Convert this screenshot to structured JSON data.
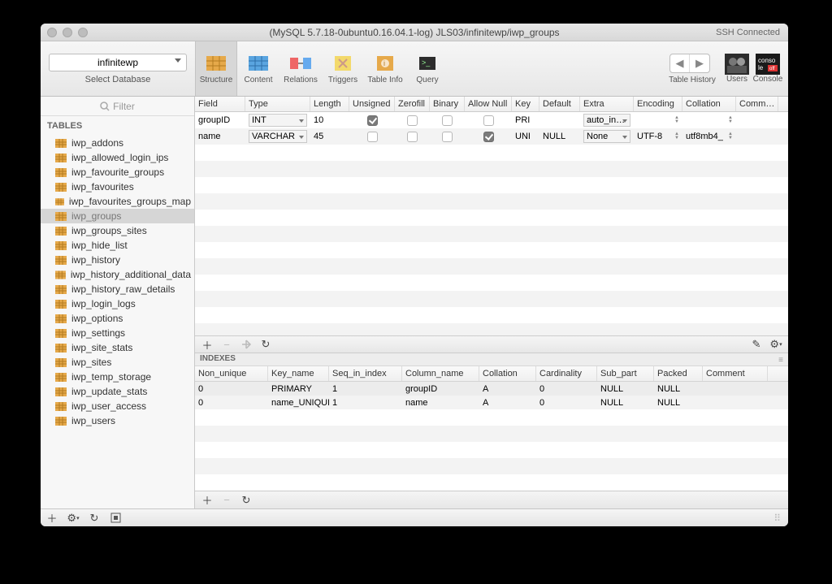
{
  "title": "(MySQL 5.7.18-0ubuntu0.16.04.1-log) JLS03/infinitewp/iwp_groups",
  "ssh_status": "SSH Connected",
  "db_selector": {
    "value": "infinitewp",
    "label": "Select Database"
  },
  "toolbar_icons": [
    {
      "label": "Structure"
    },
    {
      "label": "Content"
    },
    {
      "label": "Relations"
    },
    {
      "label": "Triggers"
    },
    {
      "label": "Table Info"
    },
    {
      "label": "Query"
    }
  ],
  "nav_label": "Table History",
  "users_label": "Users",
  "console_label": "Console",
  "filter_placeholder": "Filter",
  "tables_header": "TABLES",
  "tables": [
    "iwp_addons",
    "iwp_allowed_login_ips",
    "iwp_favourite_groups",
    "iwp_favourites",
    "iwp_favourites_groups_map",
    "iwp_groups",
    "iwp_groups_sites",
    "iwp_hide_list",
    "iwp_history",
    "iwp_history_additional_data",
    "iwp_history_raw_details",
    "iwp_login_logs",
    "iwp_options",
    "iwp_settings",
    "iwp_site_stats",
    "iwp_sites",
    "iwp_temp_storage",
    "iwp_update_stats",
    "iwp_user_access",
    "iwp_users"
  ],
  "selected_table": "iwp_groups",
  "columns_header": [
    "Field",
    "Type",
    "Length",
    "Unsigned",
    "Zerofill",
    "Binary",
    "Allow Null",
    "Key",
    "Default",
    "Extra",
    "Encoding",
    "Collation",
    "Comm…"
  ],
  "columns": [
    {
      "field": "groupID",
      "type": "INT",
      "length": "10",
      "unsigned": true,
      "zerofill": false,
      "binary": false,
      "allow_null": false,
      "key": "PRI",
      "default": "",
      "extra": "auto_in…",
      "encoding": "",
      "collation": ""
    },
    {
      "field": "name",
      "type": "VARCHAR",
      "length": "45",
      "unsigned": false,
      "zerofill": false,
      "binary": false,
      "allow_null": true,
      "key": "UNI",
      "default": "NULL",
      "extra": "None",
      "encoding": "UTF-8",
      "collation": "utf8mb4_"
    }
  ],
  "indexes_title": "INDEXES",
  "indexes_header": [
    "Non_unique",
    "Key_name",
    "Seq_in_index",
    "Column_name",
    "Collation",
    "Cardinality",
    "Sub_part",
    "Packed",
    "Comment"
  ],
  "indexes": [
    {
      "non_unique": "0",
      "key_name": "PRIMARY",
      "seq": "1",
      "col": "groupID",
      "coll": "A",
      "card": "0",
      "sub": "NULL",
      "packed": "NULL",
      "comment": ""
    },
    {
      "non_unique": "0",
      "key_name": "name_UNIQUE",
      "seq": "1",
      "col": "name",
      "coll": "A",
      "card": "0",
      "sub": "NULL",
      "packed": "NULL",
      "comment": ""
    }
  ]
}
